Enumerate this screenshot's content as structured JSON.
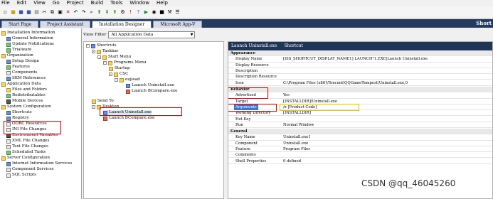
{
  "menubar": {
    "items": [
      "File",
      "Edit",
      "View",
      "Go",
      "Project",
      "Build",
      "Tools",
      "Window",
      "Help"
    ]
  },
  "tabs": {
    "items": [
      "Start Page",
      "Project Assistant",
      "Installation Designer",
      "Microsoft App-V"
    ],
    "right_label": "Short"
  },
  "left_nav": {
    "groups": [
      {
        "label": "Installation Information",
        "items": [
          "General Information",
          "Update Notifications",
          "Trialware"
        ]
      },
      {
        "label": "Organization",
        "items": [
          "Setup Design",
          "Features",
          "Components",
          "SKM References"
        ]
      },
      {
        "label": "Application Data",
        "items": [
          "Files and Folders",
          "Redistributables",
          "Mobile Devices"
        ]
      },
      {
        "label": "System Configuration",
        "items": [
          "Shortcuts",
          "Registry",
          "ODBC Resources",
          "INI File Changes",
          "Environment Variables",
          "XML File Changes",
          "Text File Changes",
          "Scheduled Tasks"
        ]
      },
      {
        "label": "Server Configuration",
        "items": [
          "Internet Information Services",
          "Component Services",
          "SQL Scripts"
        ]
      }
    ]
  },
  "view_filter": {
    "label": "View Filter",
    "value": "All Application Data"
  },
  "tree": {
    "nodes": [
      "Shortcuts",
      "Taskbar",
      "Start Menu",
      "Programs Menu",
      "Startup",
      "CSC",
      "eujiead",
      "Launch Uninstall.exe",
      "Launch BCompare.exe",
      "Send To",
      "Desktop",
      "Launch Uninstall.exe",
      "Launch BCompare.exe"
    ]
  },
  "grid": {
    "header_title": "Launch Uninstall.exe",
    "header_subtitle": "Shortcut",
    "sections": {
      "appearance": "Appearance",
      "behavior": "Behavior",
      "general": "General"
    },
    "rows": [
      {
        "key": "Display Name",
        "value": "[ISS_SHORTCUT_DISPLAY_NAME1] LAUNCH\"1.EXE|Launch Uninstall.exe"
      },
      {
        "key": "Display Resource",
        "value": ""
      },
      {
        "key": "Description",
        "value": ""
      },
      {
        "key": "Description Resource",
        "value": ""
      },
      {
        "key": "Icon",
        "value": "C:\\Program Files (x86)\\Tencent\\QQGameTempest\\Uninstall.exe,0"
      },
      {
        "key": "Advertised",
        "value": "Yes"
      },
      {
        "key": "Target",
        "value": "[INSTALLDIR]\\Uninstall.exe"
      },
      {
        "key": "Arguments",
        "value": "/x [Product Code]"
      },
      {
        "key": "Working Directory",
        "value": "[INSTALLDIR]"
      },
      {
        "key": "Hot Key",
        "value": ""
      },
      {
        "key": "Run",
        "value": "Normal Window"
      },
      {
        "key": "Key Name",
        "value": "Uninstall.exe1"
      },
      {
        "key": "Component",
        "value": "Uninstall.exe"
      },
      {
        "key": "Feature",
        "value": "Program Files"
      },
      {
        "key": "Comments",
        "value": ""
      },
      {
        "key": "Shell Properties",
        "value": "0 defined"
      }
    ]
  },
  "watermark": "CSDN @qq_46045260"
}
